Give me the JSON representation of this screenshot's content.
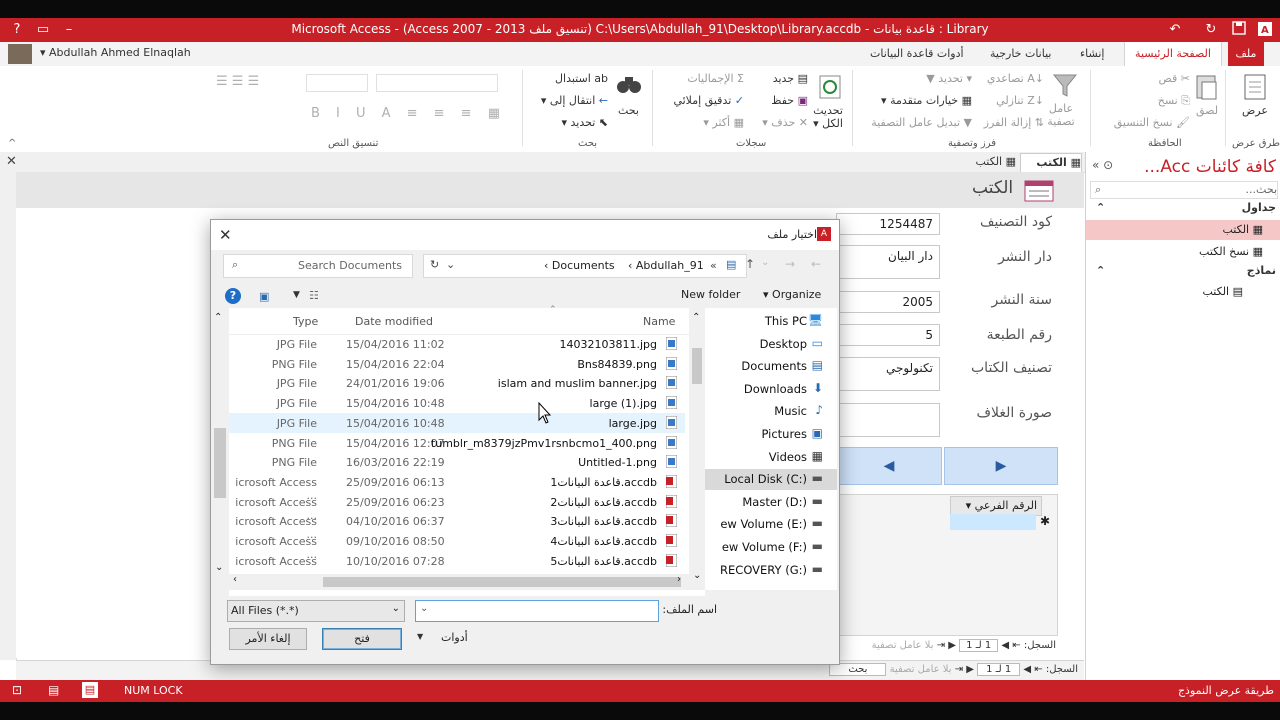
{
  "window": {
    "title": "Microsoft Access  - (Access 2007 - 2013 تنسيق ملف) C:\\Users\\Abdullah_91\\Desktop\\Library.accdb - قاعدة بيانات : Library",
    "user": "Abdullah Ahmed Elnaqlah"
  },
  "tabs": [
    "ملف",
    "الصفحة الرئيسية",
    "إنشاء",
    "بيانات خارجية",
    "أدوات قاعدة البيانات"
  ],
  "ribbon": {
    "views": {
      "label": "عرض",
      "group": "طرق عرض"
    },
    "clipboard": {
      "paste": "لصق",
      "cut": "قص",
      "copy": "نسخ",
      "format_painter": "نسخ التنسيق",
      "group": "الحافظة"
    },
    "sort_filter": {
      "filter": "عامل تصفية",
      "ascending": "تصاعدي",
      "descending": "تنازلي",
      "remove_sort": "إزالة الفرز",
      "selection": "تحديد",
      "advanced": "خيارات متقدمة",
      "toggle_filter": "تبديل عامل التصفية",
      "group": "فرز وتصفية"
    },
    "records": {
      "refresh": "تحديث الكل",
      "new": "جديد",
      "save": "حفظ",
      "delete": "حذف",
      "totals": "الإجماليات",
      "spelling": "تدقيق إملائي",
      "more": "أكثر",
      "group": "سجلات"
    },
    "find": {
      "find": "بحث",
      "replace": "استبدال",
      "goto": "انتقال إلى",
      "select": "تحديد",
      "group": "بحث"
    },
    "text_format": {
      "group": "تنسيق النص"
    }
  },
  "nav_pane": {
    "title": "كافة كائنات Acc...",
    "search_placeholder": "بحث...",
    "sections": [
      {
        "label": "جداول",
        "items": [
          "الكتب",
          "نسخ الكتب"
        ]
      },
      {
        "label": "نماذج",
        "items": [
          "الكتب"
        ]
      }
    ]
  },
  "doc_tabs": [
    "الكتب",
    "الكتب"
  ],
  "form": {
    "title": "الكتب",
    "fields": [
      {
        "label": "كود التصنيف",
        "value": "1254487"
      },
      {
        "label": "دار النشر",
        "value": "دار البيان"
      },
      {
        "label": "سنة النشر",
        "value": "2005"
      },
      {
        "label": "رقم الطبعة",
        "value": "5"
      },
      {
        "label": "تصنيف الكتاب",
        "value": "تكنولوجي"
      },
      {
        "label": "صورة الغلاف",
        "value": ""
      }
    ],
    "subform_column": "الرقم الفرعي",
    "record_nav": {
      "label": "السجل:",
      "current": "1 لـ 1",
      "no_filter": "بلا عامل تصفية",
      "search": "بحث"
    }
  },
  "dialog": {
    "title": "اختيار ملف",
    "breadcrumb": [
      "Abdullah_91",
      "Documents"
    ],
    "search_placeholder": "Search Documents",
    "toolbar": {
      "organize": "Organize",
      "new_folder": "New folder"
    },
    "columns": {
      "name": "Name",
      "date": "Date modified",
      "type": "Type"
    },
    "files": [
      {
        "name": "14032103811.jpg",
        "date": "15/04/2016 11:02",
        "type": "JPG File",
        "kind": "img"
      },
      {
        "name": "Bns84839.png",
        "date": "15/04/2016 22:04",
        "type": "PNG File",
        "kind": "img"
      },
      {
        "name": "islam and muslim banner.jpg",
        "date": "24/01/2016 19:06",
        "type": "JPG File",
        "kind": "img"
      },
      {
        "name": "large (1).jpg",
        "date": "15/04/2016 10:48",
        "type": "JPG File",
        "kind": "img"
      },
      {
        "name": "large.jpg",
        "date": "15/04/2016 10:48",
        "type": "JPG File",
        "kind": "img"
      },
      {
        "name": "tumblr_m8379jzPmv1rsnbcmo1_400.png",
        "date": "15/04/2016 12:07",
        "type": "PNG File",
        "kind": "img"
      },
      {
        "name": "Untitled-1.png",
        "date": "16/03/2016 22:19",
        "type": "PNG File",
        "kind": "img"
      },
      {
        "name": "قاعدة البيانات1.accdb",
        "date": "25/09/2016 06:13",
        "type": "icrosoft Access ...",
        "kind": "access"
      },
      {
        "name": "قاعدة البيانات2.accdb",
        "date": "25/09/2016 06:23",
        "type": "icrosoft Access ...",
        "kind": "access"
      },
      {
        "name": "قاعدة البيانات3.accdb",
        "date": "04/10/2016 06:37",
        "type": "icrosoft Access ...",
        "kind": "access"
      },
      {
        "name": "قاعدة البيانات4.accdb",
        "date": "09/10/2016 08:50",
        "type": "icrosoft Access ...",
        "kind": "access"
      },
      {
        "name": "قاعدة البيانات5.accdb",
        "date": "10/10/2016 07:28",
        "type": "icrosoft Access ...",
        "kind": "access"
      }
    ],
    "nav": [
      "This PC",
      "Desktop",
      "Documents",
      "Downloads",
      "Music",
      "Pictures",
      "Videos",
      "Local Disk (C:)",
      "Master (D:)",
      "ew Volume (E:)",
      "ew Volume (F:)",
      "RECOVERY (G:)"
    ],
    "filename_label": "اسم الملف:",
    "filename_value": "",
    "filter": "All Files (*.*)",
    "tools": "أدوات",
    "open": "فتح",
    "cancel": "إلغاء الأمر"
  },
  "status": {
    "left": "طريقة عرض النموذج",
    "numlock": "NUM LOCK"
  },
  "colors": {
    "accent": "#c82027",
    "selection": "#cce8ff"
  }
}
